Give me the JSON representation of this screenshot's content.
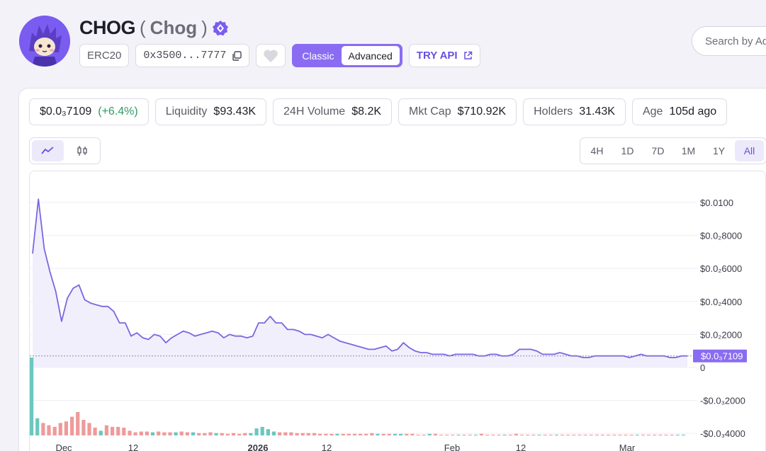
{
  "token": {
    "symbol": "CHOG",
    "name": "Chog",
    "paren_open": "(",
    "paren_close": ")",
    "standard": "ERC20",
    "address": "0x3500...7777",
    "view_toggle": {
      "classic": "Classic",
      "advanced": "Advanced",
      "selected": "Classic"
    },
    "try_api": "TRY API"
  },
  "search": {
    "placeholder": "Search by Ad"
  },
  "stats": {
    "price": "$0.0₃7109",
    "change": "(+6.4%)",
    "liquidity_label": "Liquidity",
    "liquidity": "$93.43K",
    "volume_label": "24H Volume",
    "volume": "$8.2K",
    "mktcap_label": "Mkt Cap",
    "mktcap": "$710.92K",
    "holders_label": "Holders",
    "holders": "31.43K",
    "age_label": "Age",
    "age": "105d ago"
  },
  "time_ranges": [
    "4H",
    "1D",
    "7D",
    "1M",
    "1Y",
    "All"
  ],
  "selected_range": "All",
  "colors": {
    "accent": "#8a6cf2",
    "line": "#7c66e0",
    "up": "#6cc7bf",
    "down": "#ef9a9a",
    "positive": "#2f9a62"
  },
  "icons": [
    "verified-badge-icon",
    "copy-icon",
    "heart-icon",
    "external-link-icon",
    "line-chart-icon",
    "candlestick-icon"
  ],
  "chart_data": {
    "type": "line",
    "current_price_label": "$0.0₃7109",
    "y_tick_labels": [
      "$0.0100",
      "$0.0₂8000",
      "$0.0₂6000",
      "$0.0₂4000",
      "$0.0₂2000",
      "0",
      "-$0.0₃2000",
      "-$0.0₃4000"
    ],
    "y_ticks": [
      0.01,
      0.008,
      0.006,
      0.004,
      0.002,
      0,
      -0.0002,
      -0.0004
    ],
    "x_tick_labels": [
      "Dec",
      "12",
      "2026",
      "12",
      "Feb",
      "12",
      "Mar"
    ],
    "series": [
      {
        "values": [
          0.0069,
          0.0102,
          0.0072,
          0.0058,
          0.0046,
          0.0028,
          0.0042,
          0.0048,
          0.005,
          0.0041,
          0.0039,
          0.0038,
          0.0037,
          0.0037,
          0.0034,
          0.0027,
          0.0027,
          0.0019,
          0.0021,
          0.0018,
          0.0017,
          0.002,
          0.0019,
          0.0015,
          0.0018,
          0.002,
          0.0022,
          0.0021,
          0.0019,
          0.002,
          0.0021,
          0.0022,
          0.0021,
          0.0018,
          0.002,
          0.0019,
          0.0019,
          0.0018,
          0.0019,
          0.0027,
          0.0027,
          0.0031,
          0.0027,
          0.0027,
          0.0023,
          0.0023,
          0.0022,
          0.002,
          0.002,
          0.0019,
          0.0018,
          0.002,
          0.0018,
          0.0016,
          0.0015,
          0.0014,
          0.0013,
          0.0012,
          0.0011,
          0.0011,
          0.0012,
          0.0013,
          0.001,
          0.0011,
          0.0015,
          0.0012,
          0.001,
          0.0009,
          0.0009,
          0.0008,
          0.0008,
          0.0008,
          0.0007,
          0.0008,
          0.0008,
          0.0008,
          0.0008,
          0.0007,
          0.0007,
          0.0008,
          0.0008,
          0.0007,
          0.0007,
          0.0008,
          0.0011,
          0.0011,
          0.0011,
          0.001,
          0.0008,
          0.0008,
          0.0008,
          0.0009,
          0.0008,
          0.0007,
          0.0007,
          0.0006,
          0.0006,
          0.0007,
          0.0007,
          0.0007,
          0.0007,
          0.0007,
          0.0007,
          0.0006,
          0.0007,
          0.0008,
          0.0007,
          0.0007,
          0.0007,
          0.0007,
          0.0006,
          0.0006,
          0.0007,
          0.0007
        ]
      }
    ],
    "volume": [
      {
        "v": 100,
        "up": true
      },
      {
        "v": 22,
        "up": true
      },
      {
        "v": 16,
        "up": false
      },
      {
        "v": 13,
        "up": false
      },
      {
        "v": 11,
        "up": false
      },
      {
        "v": 16,
        "up": false
      },
      {
        "v": 18,
        "up": false
      },
      {
        "v": 24,
        "up": false
      },
      {
        "v": 30,
        "up": false
      },
      {
        "v": 20,
        "up": false
      },
      {
        "v": 16,
        "up": false
      },
      {
        "v": 10,
        "up": false
      },
      {
        "v": 6,
        "up": true
      },
      {
        "v": 13,
        "up": false
      },
      {
        "v": 11,
        "up": false
      },
      {
        "v": 11,
        "up": false
      },
      {
        "v": 10,
        "up": false
      },
      {
        "v": 6,
        "up": false
      },
      {
        "v": 4,
        "up": false
      },
      {
        "v": 5,
        "up": false
      },
      {
        "v": 5,
        "up": false
      },
      {
        "v": 4,
        "up": true
      },
      {
        "v": 5,
        "up": false
      },
      {
        "v": 4,
        "up": false
      },
      {
        "v": 4,
        "up": false
      },
      {
        "v": 4,
        "up": true
      },
      {
        "v": 5,
        "up": false
      },
      {
        "v": 4,
        "up": false
      },
      {
        "v": 4,
        "up": true
      },
      {
        "v": 3,
        "up": false
      },
      {
        "v": 3,
        "up": false
      },
      {
        "v": 4,
        "up": false
      },
      {
        "v": 3,
        "up": true
      },
      {
        "v": 3,
        "up": false
      },
      {
        "v": 2,
        "up": false
      },
      {
        "v": 3,
        "up": false
      },
      {
        "v": 2,
        "up": false
      },
      {
        "v": 3,
        "up": false
      },
      {
        "v": 3,
        "up": true
      },
      {
        "v": 9,
        "up": true
      },
      {
        "v": 11,
        "up": true
      },
      {
        "v": 8,
        "up": true
      },
      {
        "v": 5,
        "up": true
      },
      {
        "v": 4,
        "up": false
      },
      {
        "v": 4,
        "up": false
      },
      {
        "v": 4,
        "up": false
      },
      {
        "v": 3,
        "up": false
      },
      {
        "v": 3,
        "up": false
      },
      {
        "v": 3,
        "up": false
      },
      {
        "v": 3,
        "up": false
      },
      {
        "v": 2,
        "up": false
      },
      {
        "v": 2,
        "up": false
      },
      {
        "v": 2,
        "up": false
      },
      {
        "v": 2,
        "up": true
      },
      {
        "v": 2,
        "up": false
      },
      {
        "v": 2,
        "up": false
      },
      {
        "v": 2,
        "up": false
      },
      {
        "v": 2,
        "up": false
      },
      {
        "v": 2,
        "up": false
      },
      {
        "v": 3,
        "up": false
      },
      {
        "v": 2,
        "up": true
      },
      {
        "v": 2,
        "up": false
      },
      {
        "v": 2,
        "up": false
      },
      {
        "v": 2,
        "up": true
      },
      {
        "v": 2,
        "up": true
      },
      {
        "v": 2,
        "up": false
      },
      {
        "v": 2,
        "up": false
      },
      {
        "v": 1,
        "up": false
      },
      {
        "v": 1,
        "up": false
      },
      {
        "v": 2,
        "up": true
      },
      {
        "v": 2,
        "up": false
      },
      {
        "v": 1,
        "up": false
      },
      {
        "v": 1,
        "up": false
      },
      {
        "v": 1,
        "up": false
      },
      {
        "v": 1,
        "up": true
      },
      {
        "v": 1,
        "up": false
      },
      {
        "v": 1,
        "up": false
      },
      {
        "v": 1,
        "up": true
      },
      {
        "v": 2,
        "up": false
      },
      {
        "v": 1,
        "up": false
      },
      {
        "v": 1,
        "up": false
      },
      {
        "v": 1,
        "up": false
      },
      {
        "v": 1,
        "up": true
      },
      {
        "v": 1,
        "up": false
      },
      {
        "v": 2,
        "up": false
      },
      {
        "v": 1,
        "up": false
      },
      {
        "v": 1,
        "up": false
      },
      {
        "v": 1,
        "up": false
      },
      {
        "v": 1,
        "up": true
      },
      {
        "v": 1,
        "up": false
      },
      {
        "v": 1,
        "up": false
      },
      {
        "v": 1,
        "up": true
      },
      {
        "v": 1,
        "up": false
      },
      {
        "v": 1,
        "up": false
      },
      {
        "v": 1,
        "up": false
      },
      {
        "v": 1,
        "up": false
      },
      {
        "v": 1,
        "up": false
      },
      {
        "v": 1,
        "up": false
      },
      {
        "v": 1,
        "up": false
      },
      {
        "v": 1,
        "up": false
      },
      {
        "v": 1,
        "up": false
      },
      {
        "v": 1,
        "up": false
      },
      {
        "v": 1,
        "up": false
      },
      {
        "v": 1,
        "up": false
      },
      {
        "v": 1,
        "up": false
      },
      {
        "v": 1,
        "up": true
      },
      {
        "v": 1,
        "up": false
      },
      {
        "v": 1,
        "up": false
      },
      {
        "v": 1,
        "up": false
      },
      {
        "v": 1,
        "up": false
      },
      {
        "v": 1,
        "up": false
      },
      {
        "v": 1,
        "up": false
      },
      {
        "v": 1,
        "up": true
      },
      {
        "v": 1,
        "up": true
      }
    ],
    "grid": true
  }
}
